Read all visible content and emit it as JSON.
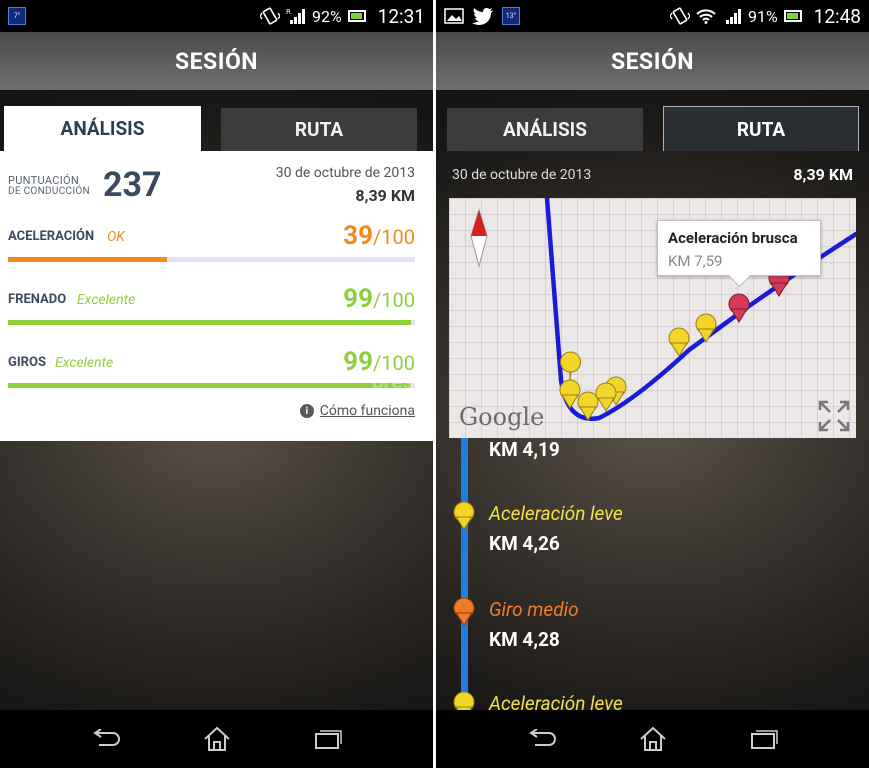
{
  "left": {
    "status": {
      "temp": "7°",
      "battery_pct": "92%",
      "time": "12:31"
    },
    "title": "SESIÓN",
    "tabs": {
      "analysis": "ANÁLISIS",
      "route": "RUTA"
    },
    "score": {
      "label_line1": "PUNTUACIÓN",
      "label_line2": "DE CONDUCCIÓN",
      "value": "237"
    },
    "date": "30 de octubre de 2013",
    "distance": "8,39 KM",
    "metrics": [
      {
        "name": "ACELERACIÓN",
        "rating": "OK",
        "score": "39",
        "denom": "/100",
        "value": 39,
        "color": "#f28a1e"
      },
      {
        "name": "FRENADO",
        "rating": "Excelente",
        "score": "99",
        "denom": "/100",
        "value": 99,
        "color": "#8fcf3c"
      },
      {
        "name": "GIROS",
        "rating": "Excelente",
        "score": "99",
        "denom": "/100",
        "value": 99,
        "color": "#8fcf3c"
      }
    ],
    "how_label": "Cómo funciona"
  },
  "right": {
    "status": {
      "temp": "13°",
      "battery_pct": "91%",
      "time": "12:48"
    },
    "title": "SESIÓN",
    "tabs": {
      "analysis": "ANÁLISIS",
      "route": "RUTA"
    },
    "date": "30 de octubre de 2013",
    "distance": "8,39 KM",
    "map": {
      "provider": "Google",
      "callout_title": "Aceleración brusca",
      "callout_sub": "KM 7,59"
    },
    "timeline_top_km": "KM 4,19",
    "events": [
      {
        "type": "Aceleración leve",
        "km": "KM 4,26",
        "color": "#f2e04a"
      },
      {
        "type": "Giro medio",
        "km": "KM 4,28",
        "color": "#f07a28"
      },
      {
        "type": "Aceleración leve",
        "km": "",
        "color": "#f2e04a"
      }
    ]
  },
  "watermark": "ores",
  "colors": {
    "accent_blue": "#1e7fe0",
    "pin_yellow": "#f2d52a",
    "pin_red": "#d63a5a"
  }
}
